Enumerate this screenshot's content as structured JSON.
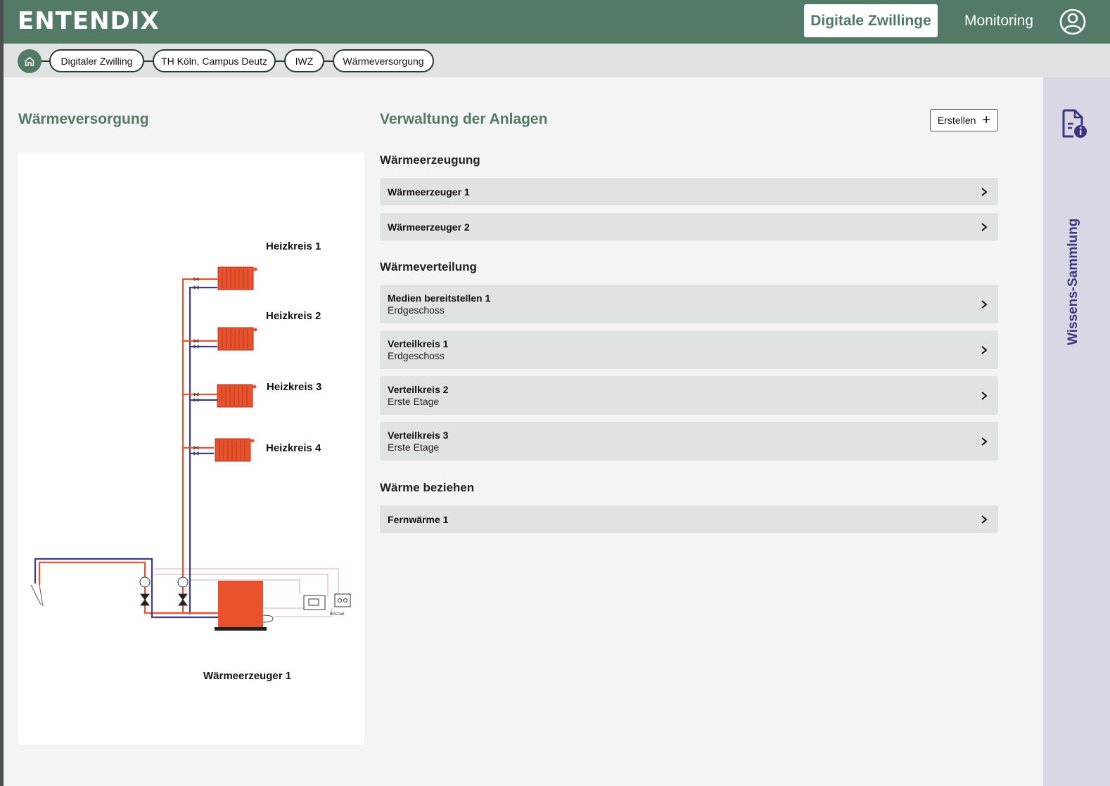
{
  "header": {
    "logo": "ENTENDIX",
    "nav_active": "Digitale Zwillinge",
    "nav_link": "Monitoring",
    "user_icon": "user-circle-icon"
  },
  "breadcrumb": {
    "home_icon": "home-icon",
    "items": [
      {
        "label": "Digitaler Zwilling"
      },
      {
        "label": "TH Köln, Campus Deutz"
      },
      {
        "label": "IWZ"
      },
      {
        "label": "Wärmeversorgung"
      }
    ]
  },
  "sidebar": {
    "icon": "document-info-icon",
    "label": "Wissens-Sammlung"
  },
  "left": {
    "title": "Wärmeversorgung",
    "diagram": {
      "circuits": [
        "Heizkreis 1",
        "Heizkreis 2",
        "Heizkreis 3",
        "Heizkreis 4"
      ],
      "generator_label": "Wärmeerzeuger 1",
      "bacnet_label": "BACnet",
      "colors": {
        "supply": "#e8532d",
        "return": "#3f3a8c",
        "radiator": "#e8532d",
        "control": "#e2a7b4"
      }
    }
  },
  "right": {
    "title": "Verwaltung der Anlagen",
    "create_label": "Erstellen",
    "sections": [
      {
        "heading": "Wärmeerzeugung",
        "rows": [
          {
            "title": "Wärmeerzeuger 1",
            "subtitle": ""
          },
          {
            "title": "Wärmeerzeuger 2",
            "subtitle": ""
          }
        ]
      },
      {
        "heading": "Wärmeverteilung",
        "rows": [
          {
            "title": "Medien bereitstellen 1",
            "subtitle": "Erdgeschoss"
          },
          {
            "title": "Verteilkreis 1",
            "subtitle": "Erdgeschoss"
          },
          {
            "title": "Verteilkreis 2",
            "subtitle": "Erste Etage"
          },
          {
            "title": "Verteilkreis 3",
            "subtitle": "Erste Etage"
          }
        ]
      },
      {
        "heading": "Wärme beziehen",
        "rows": [
          {
            "title": "Fernwärme 1",
            "subtitle": ""
          }
        ]
      }
    ]
  },
  "colors": {
    "brand_green": "#527a67",
    "sidebar_bg": "#d8d7e3",
    "sidebar_text": "#3a3580",
    "row_bg": "#dfe3e1"
  }
}
